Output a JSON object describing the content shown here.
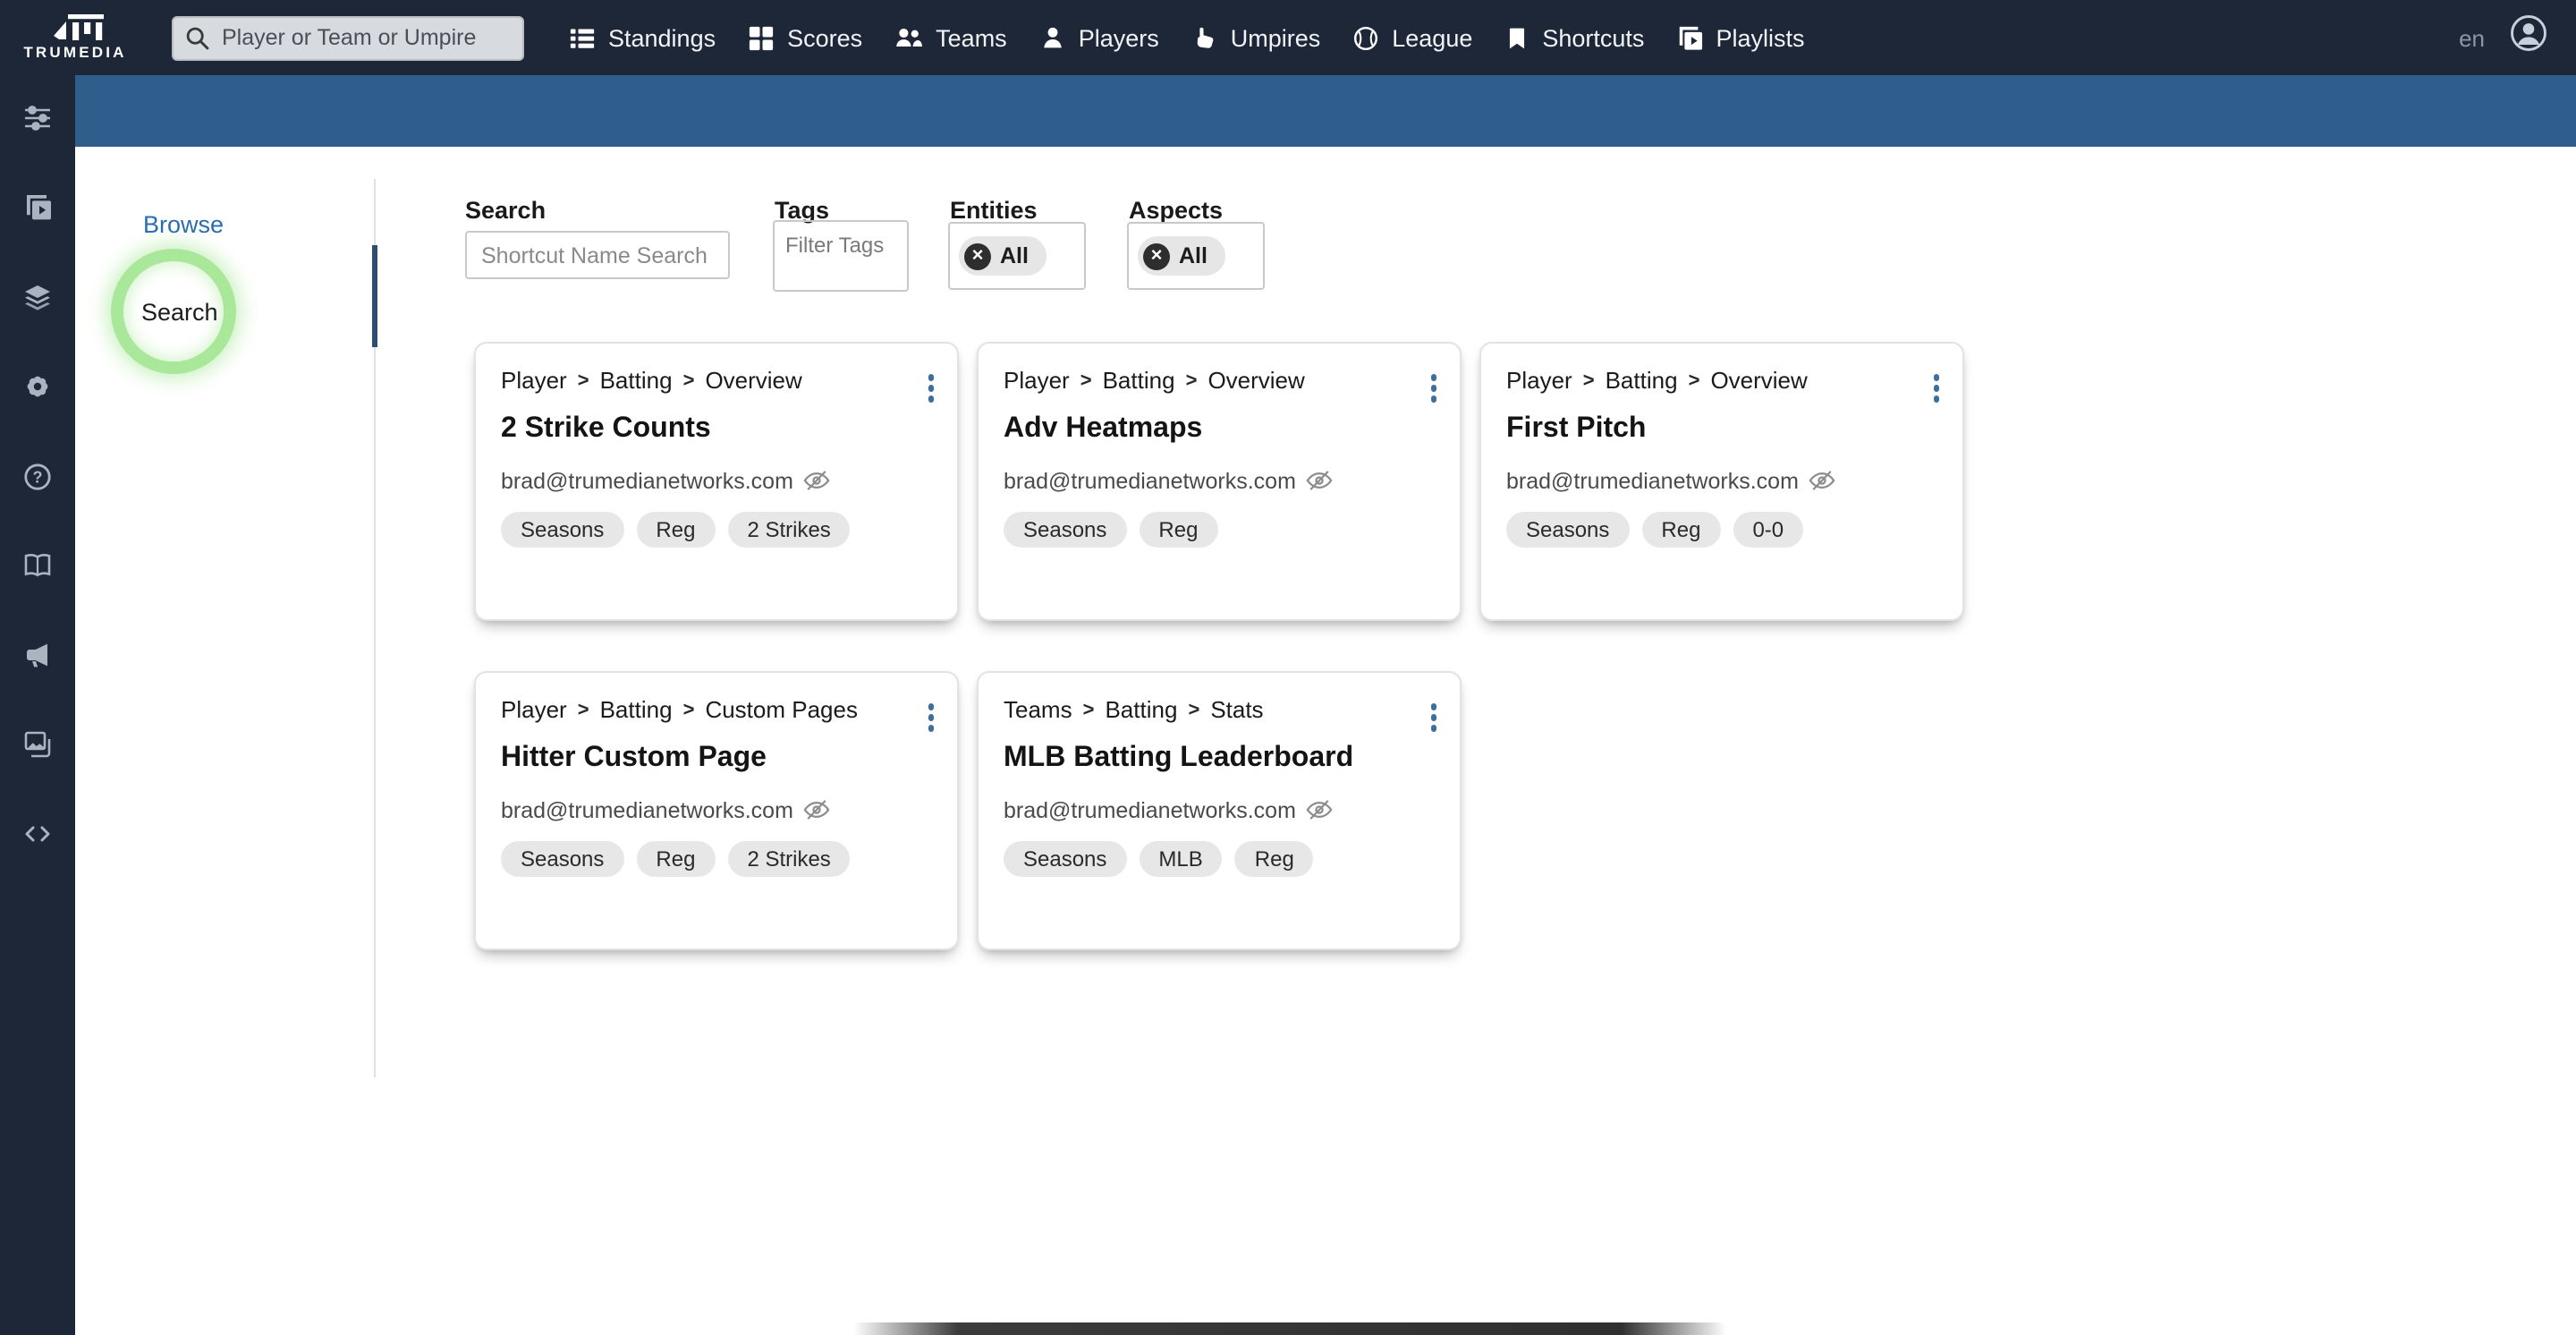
{
  "topbar": {
    "logo_text": "TRUMEDIA",
    "search_placeholder": "Player or Team or Umpire",
    "nav": [
      {
        "label": "Standings",
        "icon": "standings-icon"
      },
      {
        "label": "Scores",
        "icon": "scores-icon"
      },
      {
        "label": "Teams",
        "icon": "teams-icon"
      },
      {
        "label": "Players",
        "icon": "players-icon"
      },
      {
        "label": "Umpires",
        "icon": "umpires-icon"
      },
      {
        "label": "League",
        "icon": "league-icon"
      },
      {
        "label": "Shortcuts",
        "icon": "shortcuts-icon"
      },
      {
        "label": "Playlists",
        "icon": "playlists-icon"
      }
    ],
    "language": "en"
  },
  "sidebar": {
    "icons": [
      "filter-icon",
      "video-playlist-icon",
      "layers-icon",
      "gear-icon",
      "help-icon",
      "book-icon",
      "megaphone-icon",
      "gallery-icon",
      "code-icon"
    ]
  },
  "subnav": {
    "browse_label": "Browse",
    "search_label": "Search"
  },
  "filters": {
    "search_label": "Search",
    "search_placeholder": "Shortcut Name Search",
    "tags_label": "Tags",
    "tags_placeholder": "Filter Tags",
    "entities_label": "Entities",
    "entities_value": "All",
    "aspects_label": "Aspects",
    "aspects_value": "All"
  },
  "cards": [
    {
      "breadcrumb": [
        "Player",
        "Batting",
        "Overview"
      ],
      "title": "2 Strike Counts",
      "owner": "brad@trumedianetworks.com",
      "tags": [
        "Seasons",
        "Reg",
        "2 Strikes"
      ]
    },
    {
      "breadcrumb": [
        "Player",
        "Batting",
        "Overview"
      ],
      "title": "Adv Heatmaps",
      "owner": "brad@trumedianetworks.com",
      "tags": [
        "Seasons",
        "Reg"
      ]
    },
    {
      "breadcrumb": [
        "Player",
        "Batting",
        "Overview"
      ],
      "title": "First Pitch",
      "owner": "brad@trumedianetworks.com",
      "tags": [
        "Seasons",
        "Reg",
        "0-0"
      ]
    },
    {
      "breadcrumb": [
        "Player",
        "Batting",
        "Custom Pages"
      ],
      "title": "Hitter Custom Page",
      "owner": "brad@trumedianetworks.com",
      "tags": [
        "Seasons",
        "Reg",
        "2 Strikes"
      ]
    },
    {
      "breadcrumb": [
        "Teams",
        "Batting",
        "Stats"
      ],
      "title": "MLB Batting Leaderboard",
      "owner": "brad@trumedianetworks.com",
      "tags": [
        "Seasons",
        "MLB",
        "Reg"
      ]
    }
  ],
  "colors": {
    "navy": "#1d2737",
    "band_blue": "#2f5d8c",
    "link_blue": "#2b6cb0",
    "highlight_green": "#8ce078",
    "pill_bg": "#e7e7e7"
  }
}
